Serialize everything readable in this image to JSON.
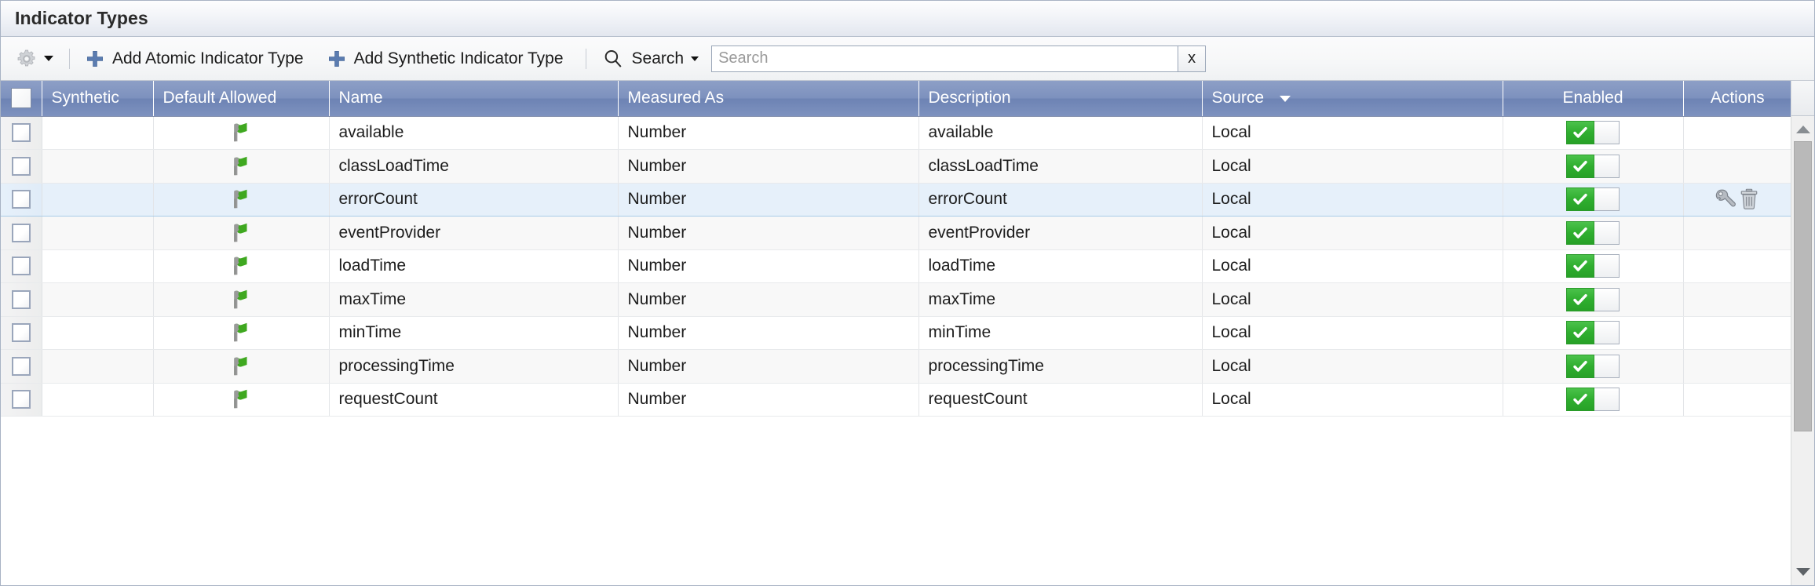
{
  "window": {
    "title": "Indicator Types"
  },
  "toolbar": {
    "gear_icon": "gear-icon",
    "gear_caret": "chevron-down-icon",
    "add_atomic_label": "Add Atomic Indicator Type",
    "add_synthetic_label": "Add Synthetic Indicator Type",
    "search_menu_label": "Search",
    "search_icon": "search-icon",
    "search_value": "",
    "search_placeholder": "Search",
    "search_clear_label": "x"
  },
  "grid": {
    "columns": [
      {
        "key": "check",
        "label": "",
        "sorted": false
      },
      {
        "key": "synthetic",
        "label": "Synthetic",
        "sorted": false
      },
      {
        "key": "flag",
        "label": "Default Allowed",
        "sorted": false
      },
      {
        "key": "name",
        "label": "Name",
        "sorted": false
      },
      {
        "key": "measured",
        "label": "Measured As",
        "sorted": false
      },
      {
        "key": "desc",
        "label": "Description",
        "sorted": false
      },
      {
        "key": "source",
        "label": "Source",
        "sorted": true
      },
      {
        "key": "enabled",
        "label": "Enabled",
        "sorted": false
      },
      {
        "key": "actions",
        "label": "Actions",
        "sorted": false
      }
    ],
    "sort_indicator": "sort-descending-icon",
    "flag_icon": "green-flag-icon",
    "enabled_on_icon": "checkmark-icon",
    "edit_icon": "wrench-icon",
    "delete_icon": "trash-icon",
    "rows": [
      {
        "checked": false,
        "synthetic": "",
        "default_allowed": true,
        "name": "available",
        "measured_as": "Number",
        "description": "available",
        "source": "Local",
        "enabled": true,
        "selected": false,
        "actions": false
      },
      {
        "checked": false,
        "synthetic": "",
        "default_allowed": true,
        "name": "classLoadTime",
        "measured_as": "Number",
        "description": "classLoadTime",
        "source": "Local",
        "enabled": true,
        "selected": false,
        "actions": false
      },
      {
        "checked": false,
        "synthetic": "",
        "default_allowed": true,
        "name": "errorCount",
        "measured_as": "Number",
        "description": "errorCount",
        "source": "Local",
        "enabled": true,
        "selected": true,
        "actions": true
      },
      {
        "checked": false,
        "synthetic": "",
        "default_allowed": true,
        "name": "eventProvider",
        "measured_as": "Number",
        "description": "eventProvider",
        "source": "Local",
        "enabled": true,
        "selected": false,
        "actions": false
      },
      {
        "checked": false,
        "synthetic": "",
        "default_allowed": true,
        "name": "loadTime",
        "measured_as": "Number",
        "description": "loadTime",
        "source": "Local",
        "enabled": true,
        "selected": false,
        "actions": false
      },
      {
        "checked": false,
        "synthetic": "",
        "default_allowed": true,
        "name": "maxTime",
        "measured_as": "Number",
        "description": "maxTime",
        "source": "Local",
        "enabled": true,
        "selected": false,
        "actions": false
      },
      {
        "checked": false,
        "synthetic": "",
        "default_allowed": true,
        "name": "minTime",
        "measured_as": "Number",
        "description": "minTime",
        "source": "Local",
        "enabled": true,
        "selected": false,
        "actions": false
      },
      {
        "checked": false,
        "synthetic": "",
        "default_allowed": true,
        "name": "processingTime",
        "measured_as": "Number",
        "description": "processingTime",
        "source": "Local",
        "enabled": true,
        "selected": false,
        "actions": false
      },
      {
        "checked": false,
        "synthetic": "",
        "default_allowed": true,
        "name": "requestCount",
        "measured_as": "Number",
        "description": "requestCount",
        "source": "Local",
        "enabled": true,
        "selected": false,
        "actions": false
      }
    ]
  },
  "scrollbar": {
    "up_icon": "arrow-up-icon",
    "down_icon": "arrow-down-icon",
    "thumb": "scrollbar-thumb"
  },
  "colors": {
    "header_blue": "#7d91be",
    "selected_row": "#e6f0fa",
    "toggle_green": "#2fae2f",
    "accent_blue": "#4a6fa5"
  }
}
